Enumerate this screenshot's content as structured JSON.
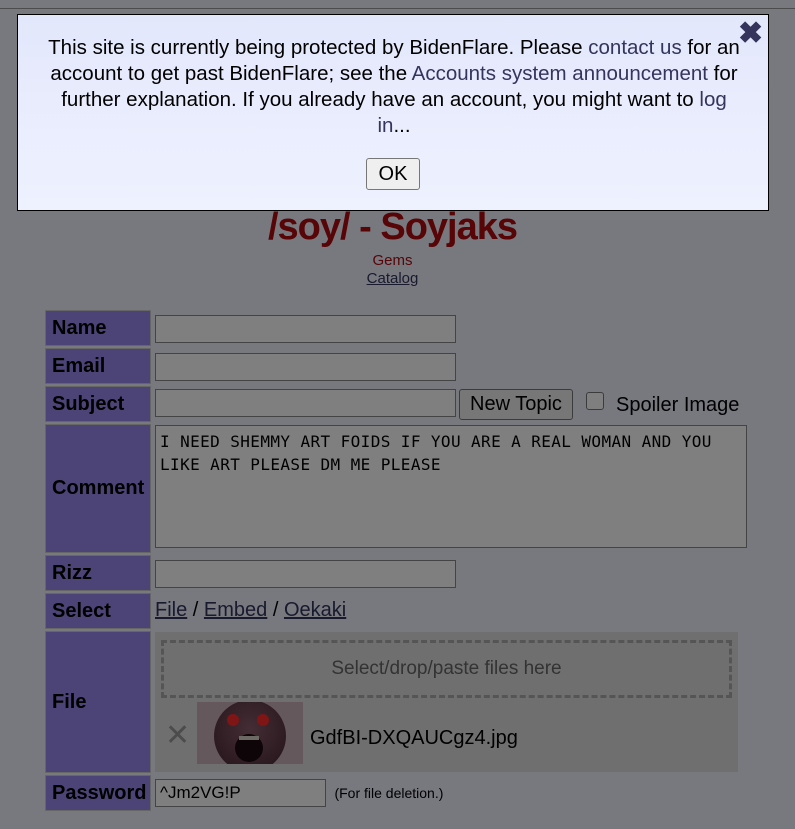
{
  "board": {
    "title": "/soy/ - Soyjaks",
    "gems_label": "Gems",
    "catalog_label": "Catalog"
  },
  "form": {
    "name_label": "Name",
    "email_label": "Email",
    "subject_label": "Subject",
    "new_topic_label": "New Topic",
    "spoiler_label": "Spoiler Image",
    "comment_label": "Comment",
    "comment_value": "I NEED SHEMMY ART FOIDS IF YOU ARE A REAL WOMAN AND YOU LIKE ART PLEASE DM ME PLEASE",
    "rizz_label": "Rizz",
    "select_label": "Select",
    "select_file": "File",
    "select_embed": "Embed",
    "select_oekaki": "Oekaki",
    "separator": "/",
    "file_label": "File",
    "dropzone_text": "Select/drop/paste files here",
    "remove_glyph": "✕",
    "attached_filename": "GdfBI-DXQAUCgz4.jpg",
    "password_label": "Password",
    "password_value": "^Jm2VG!P",
    "password_note": "(For file deletion.)"
  },
  "modal": {
    "text_1": "This site is currently being protected by BidenFlare. Please ",
    "link_contact": "contact us",
    "text_2": " for an account to get past BidenFlare; see the ",
    "link_accounts": "Accounts system announcement",
    "text_3": " for further explanation. If you already have an account, you might want to ",
    "link_login": "log in",
    "text_4": "...",
    "ok_label": "OK",
    "close_glyph": "✖"
  },
  "colors": {
    "label_bg": "#9988ee",
    "title_red": "#af0a0f",
    "link": "#34345c",
    "page_bg": "#eef2ff"
  },
  "icons": {
    "close": "close-icon",
    "remove_file": "remove-file-icon"
  }
}
